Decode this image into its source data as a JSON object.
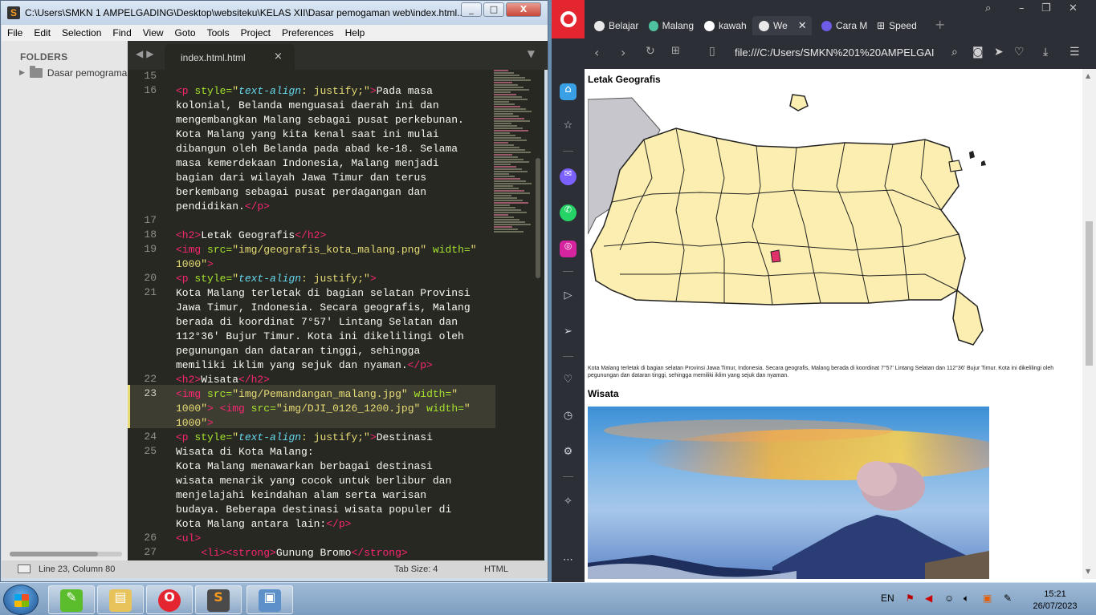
{
  "sublime": {
    "title": "C:\\Users\\SMKN 1 AMPELGADING\\Desktop\\websiteku\\KELAS XII\\Dasar pemogaman web\\index.html...",
    "menu": [
      "File",
      "Edit",
      "Selection",
      "Find",
      "View",
      "Goto",
      "Tools",
      "Project",
      "Preferences",
      "Help"
    ],
    "sidebar_heading": "FOLDERS",
    "folder_name": "Dasar pemograma",
    "tab_name": "index.html.html",
    "line_numbers": [
      {
        "n": "15",
        "row": 0
      },
      {
        "n": "16",
        "row": 1
      },
      {
        "n": "17",
        "row": 10
      },
      {
        "n": "18",
        "row": 11
      },
      {
        "n": "19",
        "row": 12
      },
      {
        "n": "20",
        "row": 14
      },
      {
        "n": "21",
        "row": 15
      },
      {
        "n": "22",
        "row": 21
      },
      {
        "n": "23",
        "row": 22
      },
      {
        "n": "24",
        "row": 25
      },
      {
        "n": "25",
        "row": 26
      },
      {
        "n": "26",
        "row": 32
      },
      {
        "n": "27",
        "row": 33
      }
    ],
    "code_lines": [
      [],
      [
        [
          "t",
          "<p"
        ],
        [
          "a",
          " style="
        ],
        [
          "s",
          "\""
        ],
        [
          "c",
          "text-align"
        ],
        [
          "s",
          ": justify;\""
        ],
        [
          "t",
          ">"
        ],
        [
          "x",
          "Pada masa"
        ]
      ],
      [
        [
          "x",
          "kolonial, Belanda menguasai daerah ini dan"
        ]
      ],
      [
        [
          "x",
          "mengembangkan Malang sebagai pusat perkebunan."
        ]
      ],
      [
        [
          "x",
          "Kota Malang yang kita kenal saat ini mulai"
        ]
      ],
      [
        [
          "x",
          "dibangun oleh Belanda pada abad ke-18. Selama"
        ]
      ],
      [
        [
          "x",
          "masa kemerdekaan Indonesia, Malang menjadi"
        ]
      ],
      [
        [
          "x",
          "bagian dari wilayah Jawa Timur dan terus"
        ]
      ],
      [
        [
          "x",
          "berkembang sebagai pusat perdagangan dan"
        ]
      ],
      [
        [
          "x",
          "pendidikan."
        ],
        [
          "t",
          "</p>"
        ]
      ],
      [],
      [
        [
          "t",
          "<h2>"
        ],
        [
          "x",
          "Letak Geografis"
        ],
        [
          "t",
          "</h2>"
        ]
      ],
      [
        [
          "t",
          "<img"
        ],
        [
          "a",
          " src="
        ],
        [
          "s",
          "\"img/geografis_kota_malang.png\""
        ],
        [
          "a",
          " width="
        ],
        [
          "s",
          "\""
        ]
      ],
      [
        [
          "s",
          "1000\""
        ],
        [
          "t",
          ">"
        ]
      ],
      [
        [
          "t",
          "<p"
        ],
        [
          "a",
          " style="
        ],
        [
          "s",
          "\""
        ],
        [
          "c",
          "text-align"
        ],
        [
          "s",
          ": justify;\""
        ],
        [
          "t",
          ">"
        ]
      ],
      [
        [
          "x",
          "Kota Malang terletak di bagian selatan Provinsi"
        ]
      ],
      [
        [
          "x",
          "Jawa Timur, Indonesia. Secara geografis, Malang"
        ]
      ],
      [
        [
          "x",
          "berada di koordinat 7°57' Lintang Selatan dan"
        ]
      ],
      [
        [
          "x",
          "112°36' Bujur Timur. Kota ini dikelilingi oleh"
        ]
      ],
      [
        [
          "x",
          "pegunungan dan dataran tinggi, sehingga"
        ]
      ],
      [
        [
          "x",
          "memiliki iklim yang sejuk dan nyaman."
        ],
        [
          "t",
          "</p>"
        ]
      ],
      [
        [
          "t",
          "<h2>"
        ],
        [
          "x",
          "Wisata"
        ],
        [
          "t",
          "</h2>"
        ]
      ],
      [
        [
          "t",
          "<img"
        ],
        [
          "a",
          " src="
        ],
        [
          "s",
          "\"img/Pemandangan_malang.jpg\""
        ],
        [
          "a",
          " width="
        ],
        [
          "s",
          "\""
        ]
      ],
      [
        [
          "s",
          "1000\""
        ],
        [
          "t",
          ">"
        ],
        [
          "x",
          " "
        ],
        [
          "t",
          "<img"
        ],
        [
          "a",
          " src="
        ],
        [
          "s",
          "\"img/DJI_0126_1200.jpg\""
        ],
        [
          "a",
          " width="
        ],
        [
          "s",
          "\""
        ]
      ],
      [
        [
          "s",
          "1000\""
        ],
        [
          "t",
          ">"
        ]
      ],
      [
        [
          "t",
          "<p"
        ],
        [
          "a",
          " style="
        ],
        [
          "s",
          "\""
        ],
        [
          "c",
          "text-align"
        ],
        [
          "s",
          ": justify;\""
        ],
        [
          "t",
          ">"
        ],
        [
          "x",
          "Destinasi"
        ]
      ],
      [
        [
          "x",
          "Wisata di Kota Malang:"
        ]
      ],
      [
        [
          "x",
          "Kota Malang menawarkan berbagai destinasi"
        ]
      ],
      [
        [
          "x",
          "wisata menarik yang cocok untuk berlibur dan"
        ]
      ],
      [
        [
          "x",
          "menjelajahi keindahan alam serta warisan"
        ]
      ],
      [
        [
          "x",
          "budaya. Beberapa destinasi wisata populer di"
        ]
      ],
      [
        [
          "x",
          "Kota Malang antara lain:"
        ],
        [
          "t",
          "</p>"
        ]
      ],
      [
        [
          "t",
          "<ul>"
        ]
      ],
      [
        [
          "x",
          "    "
        ],
        [
          "t",
          "<li><strong>"
        ],
        [
          "x",
          "Gunung Bromo"
        ],
        [
          "t",
          "</strong>"
        ]
      ]
    ],
    "status_position": "Line 23, Column 80",
    "status_tabsize": "Tab Size: 4",
    "status_syntax": "HTML"
  },
  "opera": {
    "tabs": [
      {
        "label": "Belajar",
        "active": false,
        "fav_color": "#e8e8e8"
      },
      {
        "label": "Malang",
        "active": false,
        "fav_color": "#4fc3a1"
      },
      {
        "label": "kawah",
        "active": false,
        "fav_color": "#ffffff"
      },
      {
        "label": "We",
        "active": true,
        "fav_color": "#e8e8e8"
      },
      {
        "label": "Cara M",
        "active": false,
        "fav_color": "#6c5ce7"
      },
      {
        "label": "Speed",
        "active": false,
        "fav_color": "#e8e8e8"
      }
    ],
    "url": "file:///C:/Users/SMKN%201%20AMPELGAI",
    "page": {
      "h2_geo": "Letak Geografis",
      "geo_text": "Kota Malang terletak di bagian selatan Provinsi Jawa Timur, Indonesia. Secara geografis, Malang berada di koordinat 7°57' Lintang Selatan dan 112°36' Bujur Timur. Kota ini dikelilingi oleh pegunungan dan dataran tinggi, sehingga memiliki iklim yang sejuk dan nyaman.",
      "h2_wisata": "Wisata"
    }
  },
  "taskbar": {
    "lang": "EN",
    "time": "15:21",
    "date": "26/07/2023"
  },
  "colors": {
    "opera_red": "#e3262f",
    "sublime_bg": "#272822",
    "map_fill": "#fbeeb0",
    "malang_highlight": "#e0306a"
  }
}
